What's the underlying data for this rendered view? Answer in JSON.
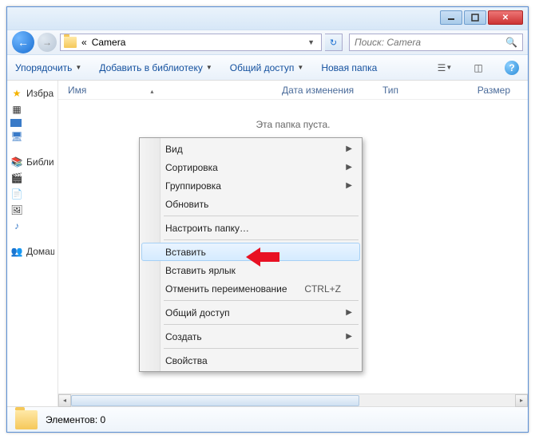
{
  "address": {
    "crumb_prefix": "«",
    "folder": "Camera"
  },
  "search": {
    "placeholder": "Поиск: Camera"
  },
  "toolbar": {
    "organize": "Упорядочить",
    "include": "Добавить в библиотеку",
    "share": "Общий доступ",
    "new_folder": "Новая папка"
  },
  "columns": {
    "name": "Имя",
    "date": "Дата изменения",
    "type": "Тип",
    "size": "Размер"
  },
  "sidebar": {
    "favorites": "Избранное",
    "libraries": "Библиотеки",
    "homegroup": "Домашняя группа"
  },
  "empty": "Эта папка пуста.",
  "status": {
    "text": "Элементов: 0"
  },
  "context": {
    "view": "Вид",
    "sort": "Сортировка",
    "group": "Группировка",
    "refresh": "Обновить",
    "customize": "Настроить папку…",
    "paste": "Вставить",
    "paste_shortcut": "Вставить ярлык",
    "undo_rename": "Отменить переименование",
    "undo_key": "CTRL+Z",
    "share": "Общий доступ",
    "new": "Создать",
    "properties": "Свойства"
  }
}
